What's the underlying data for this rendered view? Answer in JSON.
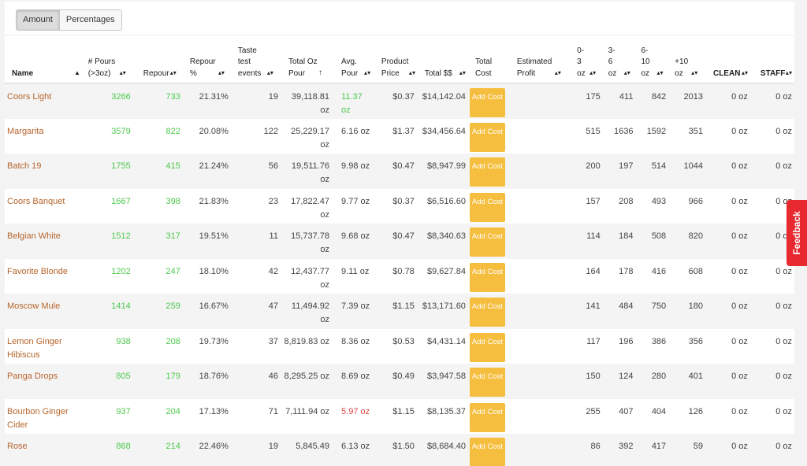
{
  "toggle": {
    "amount": "Amount",
    "percentages": "Percentages"
  },
  "headers": {
    "name": "Name",
    "pours": "# Pours (>3oz)",
    "repour": "Repour",
    "repour_pct": "Repour %",
    "taste": "Taste test events",
    "total_oz": "Total Oz Pour",
    "avg_pour": "Avg. Pour",
    "product_price": "Product Price",
    "total_dollars": "Total $$",
    "total_cost": "Total Cost",
    "est_profit": "Estimated Profit",
    "r0_3": "0-3 oz",
    "r3_6": "3-6 oz",
    "r6_10": "6-10 oz",
    "r10": "+10 oz",
    "clean": "CLEAN",
    "staff": "STAFF"
  },
  "add_cost_label": "Add Cost",
  "feedback": "Feedback",
  "rows": [
    {
      "name": "Coors Light",
      "pours": "3266",
      "repour": "733",
      "repour_pct": "21.31%",
      "taste": "19",
      "total_oz": "39,118.81 oz",
      "avg_pour": "11.37 oz",
      "avg_color": "green",
      "price": "$0.37",
      "total": "$14,142.04",
      "r0_3": "175",
      "r3_6": "411",
      "r6_10": "842",
      "r10": "2013",
      "clean": "0 oz",
      "staff": "0 oz"
    },
    {
      "name": "Margarita",
      "pours": "3579",
      "repour": "822",
      "repour_pct": "20.08%",
      "taste": "122",
      "total_oz": "25,229.17 oz",
      "avg_pour": "6.16 oz",
      "avg_color": "normal",
      "price": "$1.37",
      "total": "$34,456.64",
      "r0_3": "515",
      "r3_6": "1636",
      "r6_10": "1592",
      "r10": "351",
      "clean": "0 oz",
      "staff": "0 oz"
    },
    {
      "name": "Batch 19",
      "pours": "1755",
      "repour": "415",
      "repour_pct": "21.24%",
      "taste": "56",
      "total_oz": "19,511.76 oz",
      "avg_pour": "9.98 oz",
      "avg_color": "normal",
      "price": "$0.47",
      "total": "$8,947.99",
      "r0_3": "200",
      "r3_6": "197",
      "r6_10": "514",
      "r10": "1044",
      "clean": "0 oz",
      "staff": "0 oz"
    },
    {
      "name": "Coors Banquet",
      "pours": "1667",
      "repour": "398",
      "repour_pct": "21.83%",
      "taste": "23",
      "total_oz": "17,822.47 oz",
      "avg_pour": "9.77 oz",
      "avg_color": "normal",
      "price": "$0.37",
      "total": "$6,516.60",
      "r0_3": "157",
      "r3_6": "208",
      "r6_10": "493",
      "r10": "966",
      "clean": "0 oz",
      "staff": "0 oz"
    },
    {
      "name": "Belgian White",
      "pours": "1512",
      "repour": "317",
      "repour_pct": "19.51%",
      "taste": "11",
      "total_oz": "15,737.78 oz",
      "avg_pour": "9.68 oz",
      "avg_color": "normal",
      "price": "$0.47",
      "total": "$8,340.63",
      "r0_3": "114",
      "r3_6": "184",
      "r6_10": "508",
      "r10": "820",
      "clean": "0 oz",
      "staff": "0 oz"
    },
    {
      "name": "Favorite Blonde",
      "pours": "1202",
      "repour": "247",
      "repour_pct": "18.10%",
      "taste": "42",
      "total_oz": "12,437.77 oz",
      "avg_pour": "9.11 oz",
      "avg_color": "normal",
      "price": "$0.78",
      "total": "$9,627.84",
      "r0_3": "164",
      "r3_6": "178",
      "r6_10": "416",
      "r10": "608",
      "clean": "0 oz",
      "staff": "0 oz"
    },
    {
      "name": "Moscow Mule",
      "pours": "1414",
      "repour": "259",
      "repour_pct": "16.67%",
      "taste": "47",
      "total_oz": "11,494.92 oz",
      "avg_pour": "7.39 oz",
      "avg_color": "normal",
      "price": "$1.15",
      "total": "$13,171.60",
      "r0_3": "141",
      "r3_6": "484",
      "r6_10": "750",
      "r10": "180",
      "clean": "0 oz",
      "staff": "0 oz"
    },
    {
      "name": "Lemon Ginger Hibiscus",
      "pours": "938",
      "repour": "208",
      "repour_pct": "19.73%",
      "taste": "37",
      "total_oz": "8,819.83 oz",
      "avg_pour": "8.36 oz",
      "avg_color": "normal",
      "price": "$0.53",
      "total": "$4,431.14",
      "r0_3": "117",
      "r3_6": "196",
      "r6_10": "386",
      "r10": "356",
      "clean": "0 oz",
      "staff": "0 oz"
    },
    {
      "name": "Panga Drops",
      "pours": "805",
      "repour": "179",
      "repour_pct": "18.76%",
      "taste": "46",
      "total_oz": "8,295.25 oz",
      "avg_pour": "8.69 oz",
      "avg_color": "normal",
      "price": "$0.49",
      "total": "$3,947.58",
      "r0_3": "150",
      "r3_6": "124",
      "r6_10": "280",
      "r10": "401",
      "clean": "0 oz",
      "staff": "0 oz"
    },
    {
      "name": "Bourbon Ginger Cider",
      "pours": "937",
      "repour": "204",
      "repour_pct": "17.13%",
      "taste": "71",
      "total_oz": "7,111.94 oz",
      "avg_pour": "5.97 oz",
      "avg_color": "red",
      "price": "$1.15",
      "total": "$8,135.37",
      "r0_3": "255",
      "r3_6": "407",
      "r6_10": "404",
      "r10": "126",
      "clean": "0 oz",
      "staff": "0 oz"
    },
    {
      "name": "Rose",
      "pours": "868",
      "repour": "214",
      "repour_pct": "22.46%",
      "taste": "19",
      "total_oz": "5,845.49",
      "avg_pour": "6.13 oz",
      "avg_color": "normal",
      "price": "$1.50",
      "total": "$8,684.40",
      "r0_3": "86",
      "r3_6": "392",
      "r6_10": "417",
      "r10": "59",
      "clean": "0 oz",
      "staff": "0 oz"
    }
  ]
}
